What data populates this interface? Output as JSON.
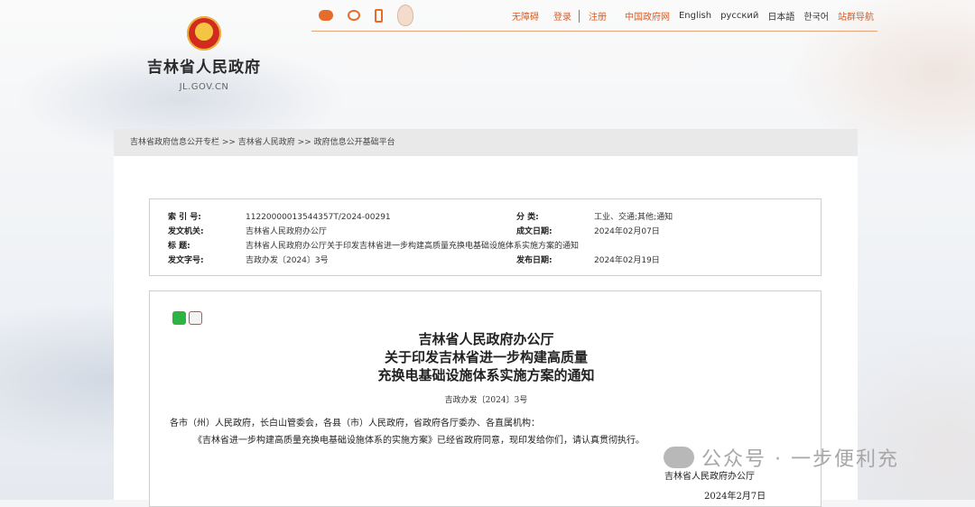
{
  "header": {
    "site_name": "吉林省人民政府",
    "site_domain": "JL.GOV.CN",
    "links": [
      "无障碍",
      "登录",
      "注册",
      "中国政府网",
      "English",
      "русский",
      "日本語",
      "한국어",
      "站群导航"
    ]
  },
  "breadcrumb": "吉林省政府信息公开专栏 >> 吉林省人民政府 >> 政府信息公开基础平台",
  "info": {
    "index_label": "索 引 号:",
    "index_value": "11220000013544357T/2024-00291",
    "category_label": "分 类:",
    "category_value": "工业、交通;其他;通知",
    "issuer_label": "发文机关:",
    "issuer_value": "吉林省人民政府办公厅",
    "date_label": "成文日期:",
    "date_value": "2024年02月07日",
    "title_label": "标 题:",
    "title_value": "吉林省人民政府办公厅关于印发吉林省进一步构建高质量充换电基础设施体系实施方案的通知",
    "docno_label": "发文字号:",
    "docno_value": "吉政办发〔2024〕3号",
    "publish_label": "发布日期:",
    "publish_value": "2024年02月19日"
  },
  "article": {
    "title_line1": "吉林省人民政府办公厅",
    "title_line2": "关于印发吉林省进一步构建高质量",
    "title_line3": "充换电基础设施体系实施方案的通知",
    "doc_no": "吉政办发〔2024〕3号",
    "para1": "各市（州）人民政府，长白山管委会，各县（市）人民政府，省政府各厅委办、各直属机构：",
    "para2": "《吉林省进一步构建高质量充换电基础设施体系的实施方案》已经省政府同意，现印发给你们，请认真贯彻执行。",
    "sign_org": "吉林省人民政府办公厅",
    "sign_date": "2024年2月7日"
  },
  "watermark": "公众号 · 一步便利充"
}
